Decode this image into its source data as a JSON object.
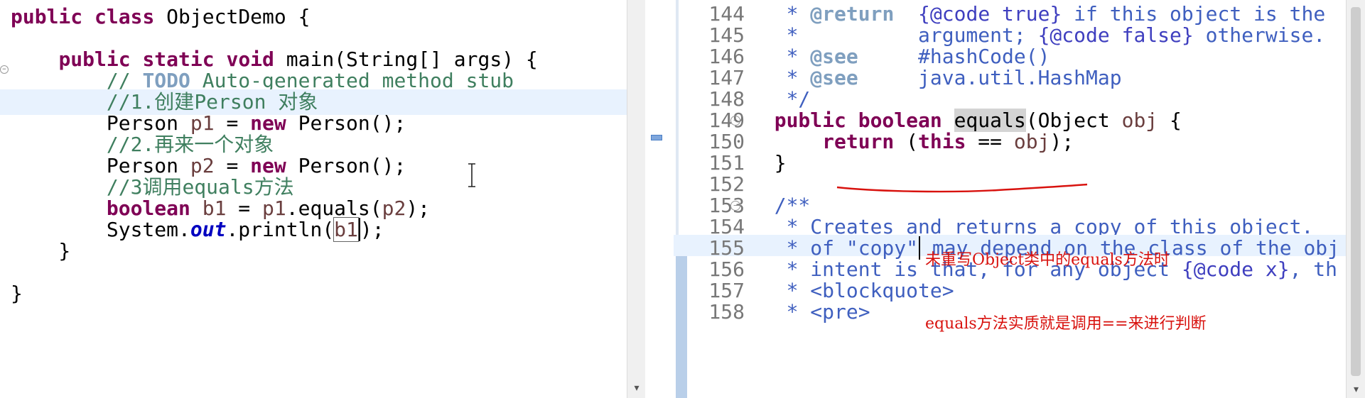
{
  "left_editor": {
    "lines": [
      {
        "id": "class-decl",
        "parts": [
          [
            "kw",
            "public "
          ],
          [
            "kw",
            "class "
          ],
          [
            "",
            "ObjectDemo {"
          ]
        ]
      },
      {
        "id": "main-decl",
        "parts": [
          [
            "",
            "    "
          ],
          [
            "kw",
            "public "
          ],
          [
            "kw",
            "static "
          ],
          [
            "kw",
            "void "
          ],
          [
            "",
            "main(String[] args) {"
          ]
        ]
      },
      {
        "id": "todo-comment",
        "parts": [
          [
            "cm",
            "        // "
          ],
          [
            "todo",
            "TODO"
          ],
          [
            "cm",
            " Auto-generated method stub"
          ]
        ]
      },
      {
        "id": "comment-1",
        "parts": [
          [
            "cm",
            "        //1."
          ],
          [
            "cmcn",
            "创建"
          ],
          [
            "cm",
            "Person "
          ],
          [
            "cmcn",
            "对象"
          ]
        ]
      },
      {
        "id": "stmt-p1",
        "parts": [
          [
            "",
            "        Person "
          ],
          [
            "var",
            "p1"
          ],
          [
            "",
            " = "
          ],
          [
            "kw",
            "new "
          ],
          [
            "",
            "Person();"
          ]
        ]
      },
      {
        "id": "comment-2",
        "parts": [
          [
            "cm",
            "        //2."
          ],
          [
            "cmcn",
            "再来一个对象"
          ]
        ]
      },
      {
        "id": "stmt-p2",
        "parts": [
          [
            "",
            "        Person "
          ],
          [
            "var",
            "p2"
          ],
          [
            "",
            " = "
          ],
          [
            "kw",
            "new "
          ],
          [
            "",
            "Person();"
          ]
        ]
      },
      {
        "id": "comment-3",
        "parts": [
          [
            "cm",
            "        //3"
          ],
          [
            "cmcn",
            "调用"
          ],
          [
            "cm",
            "equals"
          ],
          [
            "cmcn",
            "方法"
          ]
        ]
      },
      {
        "id": "stmt-b1",
        "parts": [
          [
            "kw",
            "        boolean "
          ],
          [
            "var",
            "b1"
          ],
          [
            "",
            " = "
          ],
          [
            "var",
            "p1"
          ],
          [
            "",
            ".equals("
          ],
          [
            "var",
            "p2"
          ],
          [
            "",
            ");"
          ]
        ]
      },
      {
        "id": "stmt-println",
        "parts": [
          [
            "",
            "        System."
          ],
          [
            "fld",
            "out"
          ],
          [
            "",
            ".println("
          ],
          [
            "boxed",
            "b1"
          ],
          [
            "caret",
            ");"
          ]
        ]
      },
      {
        "id": "close-main",
        "parts": [
          [
            "",
            "    }"
          ]
        ]
      },
      {
        "id": "close-class",
        "parts": [
          [
            "",
            "}"
          ]
        ]
      }
    ]
  },
  "right_editor": {
    "lines": [
      {
        "n": "144",
        "parts": [
          [
            "jd",
            "   * "
          ],
          [
            "jdtag",
            "@return"
          ],
          [
            "jd",
            "  "
          ],
          [
            "jdcode",
            "{@code true}"
          ],
          [
            "jd",
            " if this object is the"
          ]
        ]
      },
      {
        "n": "145",
        "parts": [
          [
            "jd",
            "   *          argument; "
          ],
          [
            "jdcode",
            "{@code false}"
          ],
          [
            "jd",
            " otherwise."
          ]
        ]
      },
      {
        "n": "146",
        "parts": [
          [
            "jd",
            "   * "
          ],
          [
            "jdtag",
            "@see"
          ],
          [
            "jd",
            "     #hashCode()"
          ]
        ]
      },
      {
        "n": "147",
        "parts": [
          [
            "jd",
            "   * "
          ],
          [
            "jdtag",
            "@see"
          ],
          [
            "jd",
            "     java.util.HashMap"
          ]
        ]
      },
      {
        "n": "148",
        "parts": [
          [
            "jd",
            "   */"
          ]
        ]
      },
      {
        "n": "149",
        "fold": true,
        "parts": [
          [
            "kw",
            "  public "
          ],
          [
            "kw",
            "boolean "
          ],
          [
            "sel",
            "equals"
          ],
          [
            "",
            "(Object "
          ],
          [
            "var",
            "obj"
          ],
          [
            "",
            " {"
          ]
        ]
      },
      {
        "n": "150",
        "parts": [
          [
            "kw",
            "      return "
          ],
          [
            "",
            "("
          ],
          [
            "kw",
            "this"
          ],
          [
            "",
            " == "
          ],
          [
            "var",
            "obj"
          ],
          [
            "",
            ");"
          ]
        ]
      },
      {
        "n": "151",
        "parts": [
          [
            "",
            "  }"
          ]
        ]
      },
      {
        "n": "152",
        "parts": [
          [
            "",
            ""
          ]
        ]
      },
      {
        "n": "153",
        "fold": true,
        "parts": [
          [
            "jd",
            "  /**"
          ]
        ]
      },
      {
        "n": "154",
        "parts": [
          [
            "jd",
            "   * Creates and returns a copy of this object."
          ]
        ]
      },
      {
        "n": "155",
        "hl": true,
        "parts": [
          [
            "jd",
            "   * of \"copy\""
          ],
          [
            "caret",
            ""
          ],
          [
            "jd",
            " may depend on the class of the obj"
          ]
        ]
      },
      {
        "n": "156",
        "parts": [
          [
            "jd",
            "   * intent is that, for any object "
          ],
          [
            "jdcode",
            "{@code x}"
          ],
          [
            "jd",
            ", th"
          ]
        ]
      },
      {
        "n": "157",
        "parts": [
          [
            "jd",
            "   * <blockquote>"
          ]
        ]
      },
      {
        "n": "158",
        "parts": [
          [
            "jd",
            "   * <pre>"
          ]
        ]
      }
    ]
  },
  "annotation": {
    "line1": "未重写Object类中的equals方法时",
    "line2": "equals方法实质就是调用==来进行判断"
  },
  "colors": {
    "keyword": "#7f0055",
    "comment": "#3f7f5f",
    "javadoc": "#3f5fbf",
    "annotation_red": "#d8120e",
    "current_line": "#e8f2fe"
  }
}
